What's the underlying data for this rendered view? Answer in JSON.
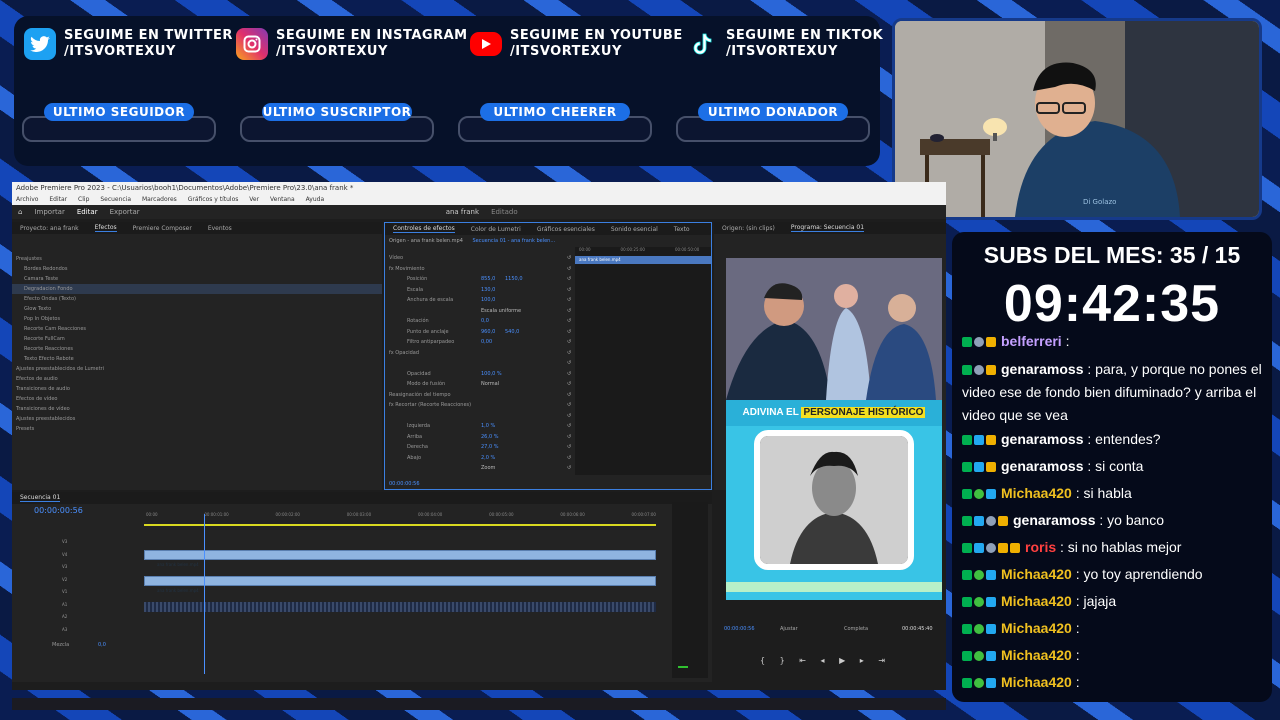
{
  "socials": [
    {
      "icon": "twitter-icon",
      "line1": "SEGUIME EN TWITTER",
      "line2": "/ITSVORTEXUY",
      "color": "#1da1f2"
    },
    {
      "icon": "instagram-icon",
      "line1": "SEGUIME EN INSTAGRAM",
      "line2": "/ITSVORTEXUY",
      "color": "#d6249f"
    },
    {
      "icon": "youtube-icon",
      "line1": "SEGUIME EN YOUTUBE",
      "line2": "/ITSVORTEXUY",
      "color": "#ff0000"
    },
    {
      "icon": "tiktok-icon",
      "line1": "SEGUIME EN TIKTOK",
      "line2": "/ITSVORTEXUY",
      "color": "#000000"
    }
  ],
  "stat_labels": [
    "ULTIMO SEGUIDOR",
    "ULTIMO SUSCRIPTOR",
    "ULTIMO CHEERER",
    "ULTIMO DONADOR"
  ],
  "premiere": {
    "title": "Adobe Premiere Pro 2023 - C:\\Usuarios\\booh1\\Documentos\\Adobe\\Premiere Pro\\23.0\\ana frank *",
    "menu": [
      "Archivo",
      "Editar",
      "Clip",
      "Secuencia",
      "Marcadores",
      "Gráficos y títulos",
      "Ver",
      "Ventana",
      "Ayuda"
    ],
    "workspaces": [
      "Importar",
      "Editar",
      "Exportar"
    ],
    "project_name": "ana frank",
    "edited": "Editado",
    "left_tabs": [
      "Proyecto: ana frank",
      "Efectos",
      "Premiere Composer",
      "Eventos"
    ],
    "tree": [
      "Preajustes",
      "Bordes Redondos",
      "Camara Teste",
      "Degradacion Fondo",
      "Efecto Ondas (Texto)",
      "Glow Texto",
      "Pop In Objetos",
      "Recorte Cam Reacciones",
      "Recorte FullCam",
      "Recorte Reacciones",
      "Texto Efecto Rebote",
      "Ajustes preestablecidos de Lumetri",
      "Efectos de audio",
      "Transiciones de audio",
      "Efectos de vídeo",
      "Transiciones de vídeo",
      "Ajustes preestablecidos",
      "Presets"
    ],
    "fx_tabs": [
      "Controles de efectos",
      "Color de Lumetri",
      "Gráficos esenciales",
      "Sonido esencial",
      "Texto"
    ],
    "fx_source": "Origen - ana frank belen.mp4",
    "fx_seq": "Secuencia 01 - ana frank belen...",
    "fx_rows": [
      {
        "name": "Vídeo",
        "v": "",
        "v2": ""
      },
      {
        "name": "fx  Movimiento",
        "v": "",
        "v2": ""
      },
      {
        "name": "Posición",
        "v": "855,0",
        "v2": "1150,0"
      },
      {
        "name": "Escala",
        "v": "130,0",
        "v2": ""
      },
      {
        "name": "Anchura de escala",
        "v": "100,0",
        "v2": ""
      },
      {
        "name": "",
        "v": "Escala uniforme",
        "v2": ""
      },
      {
        "name": "Rotación",
        "v": "0,0",
        "v2": ""
      },
      {
        "name": "Punto de anclaje",
        "v": "960,0",
        "v2": "540,0"
      },
      {
        "name": "Filtro antiparpadeo",
        "v": "0,00",
        "v2": ""
      },
      {
        "name": "fx  Opacidad",
        "v": "",
        "v2": ""
      },
      {
        "name": "",
        "v": "",
        "v2": ""
      },
      {
        "name": "Opacidad",
        "v": "100,0 %",
        "v2": ""
      },
      {
        "name": "Modo de fusión",
        "v": "Normal",
        "v2": ""
      },
      {
        "name": "Reasignación del tiempo",
        "v": "",
        "v2": ""
      },
      {
        "name": "fx  Recortar (Recorte Reacciones)",
        "v": "",
        "v2": ""
      },
      {
        "name": "",
        "v": "",
        "v2": ""
      },
      {
        "name": "Izquierda",
        "v": "1,0 %",
        "v2": ""
      },
      {
        "name": "Arriba",
        "v": "26,0 %",
        "v2": ""
      },
      {
        "name": "Derecha",
        "v": "27,0 %",
        "v2": ""
      },
      {
        "name": "Abajo",
        "v": "2,0 %",
        "v2": ""
      },
      {
        "name": "",
        "v": "Zoom",
        "v2": ""
      }
    ],
    "fx_clip": "ana frank belen.mp4",
    "fx_ruler": [
      "00:00",
      "00:00:25:00",
      "00:00:50:00",
      "00:00"
    ],
    "fx_time": "00:00:00:56",
    "program_tabs": [
      "Origen: (sin clips)",
      "Programa: Secuencia 01"
    ],
    "program_banner": "ADIVINA EL ",
    "program_banner_hl": "PERSONAJE HISTÓRICO",
    "program_time": "00:00:00:56",
    "program_fit": "Ajustar",
    "program_quality": "Completa",
    "program_duration": "00:00:45:40",
    "seq_tab": "Secuencia 01",
    "seq_time": "00:00:00:56",
    "ruler": [
      "00:00",
      "00:00:01:00",
      "00:00:02:00",
      "00:00:03:00",
      "00:00:04:00",
      "00:00:05:00",
      "00:00:06:00",
      "00:00:07:00"
    ],
    "track_labels": [
      "V3",
      "V4",
      "V3",
      "V2",
      "V1",
      "A1",
      "A2",
      "A3"
    ],
    "clip_v4": "ana frank belen.mp4",
    "clip_v2": "ana frank belen.mp4",
    "mix_label": "Mezcla",
    "mix_value": "0,0"
  },
  "chat": {
    "subs": "SUBS DEL MES: 35 / 15",
    "timer": "09:42:35",
    "messages": [
      {
        "badges": [
          "k",
          "s",
          "g"
        ],
        "nick": "belferreri",
        "nick_color": "#c4a0ff",
        "text": ":"
      },
      {
        "badges": [
          "k",
          "s",
          "g"
        ],
        "nick": "genaramoss",
        "nick_color": "#ffffff",
        "text": ": para, y porque no pones el video ese de fondo bien difuminado? y arriba el video que se vea"
      },
      {
        "badges": [
          "k",
          "c",
          "g"
        ],
        "nick": "genaramoss",
        "nick_color": "#ffffff",
        "text": ": entendes?"
      },
      {
        "badges": [
          "k",
          "c",
          "g"
        ],
        "nick": "genaramoss",
        "nick_color": "#ffffff",
        "text": ": si conta"
      },
      {
        "badges": [
          "k",
          "o",
          "c"
        ],
        "nick": "Michaa420",
        "nick_color": "#f0c020",
        "text": ": si habla"
      },
      {
        "badges": [
          "k",
          "c",
          "s",
          "g"
        ],
        "nick": "genaramoss",
        "nick_color": "#ffffff",
        "text": ": yo banco"
      },
      {
        "badges": [
          "k",
          "c",
          "s",
          "g",
          "g"
        ],
        "nick": "roris",
        "nick_color": "#ff4040",
        "text": ": si no hablas mejor"
      },
      {
        "badges": [
          "k",
          "o",
          "c"
        ],
        "nick": "Michaa420",
        "nick_color": "#f0c020",
        "text": ": yo toy aprendiendo"
      },
      {
        "badges": [
          "k",
          "o",
          "c"
        ],
        "nick": "Michaa420",
        "nick_color": "#f0c020",
        "text": ": jajaja"
      },
      {
        "badges": [
          "k",
          "o",
          "c"
        ],
        "nick": "Michaa420",
        "nick_color": "#f0c020",
        "text": ":"
      },
      {
        "badges": [
          "k",
          "o",
          "c"
        ],
        "nick": "Michaa420",
        "nick_color": "#f0c020",
        "text": ":"
      },
      {
        "badges": [
          "k",
          "o",
          "c"
        ],
        "nick": "Michaa420",
        "nick_color": "#f0c020",
        "text": ":"
      }
    ]
  }
}
